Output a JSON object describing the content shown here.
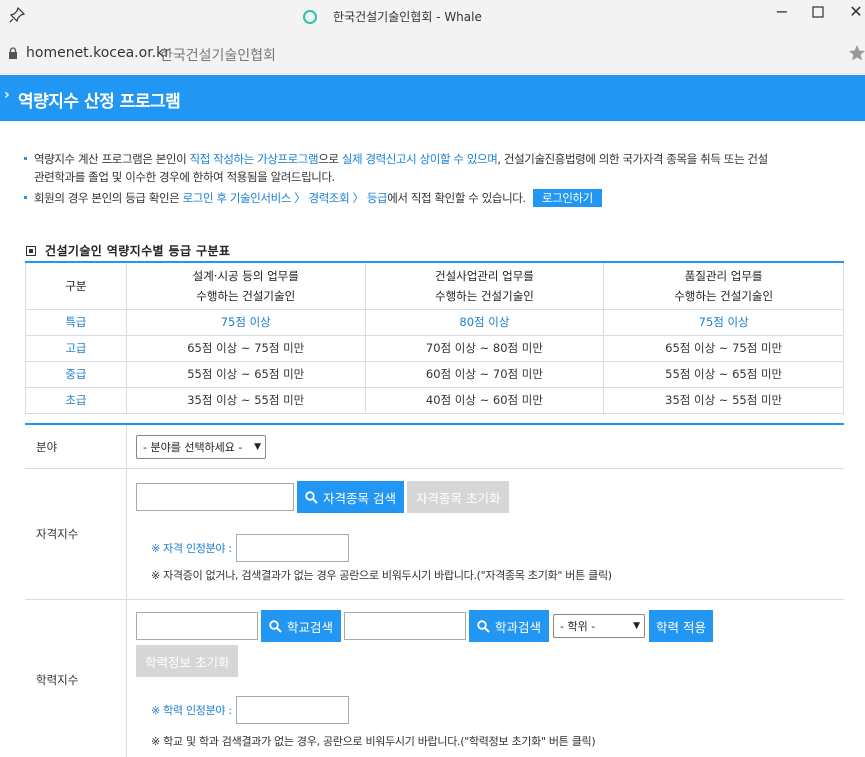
{
  "browser": {
    "window_title": "한국건설기술인협회 - Whale",
    "url": "homenet.kocea.or.kr",
    "page_title": "한국건설기술인협회"
  },
  "header": {
    "chevron": "›",
    "title": "역량지수 산정 프로그램"
  },
  "intro": {
    "line1": {
      "p1": "역량지수 계산 프로그램은 본인이 ",
      "h1": "직접 작성하는 가상프로그램",
      "p2": "으로 ",
      "h2": "실제 경력신고시 상이할 수 있으며",
      "p3": ", 건설기술진흥법령에 의한 국가자격 종목을 취득 또는 건설",
      "p4": "관련학과를 졸업 및 이수한 경우에 한하여 적용됨을 알려드립니다."
    },
    "line2": {
      "p1": "회원의 경우 본인의 등급 확인은 ",
      "h1": "로그인 후 기술인서비스 〉 경력조회 〉 등급",
      "p2": "에서 직접 확인할 수 있습니다.",
      "login_button": "로그인하기"
    }
  },
  "grade_table": {
    "title": "건설기술인 역량지수별 등급 구분표",
    "headers": [
      {
        "l1": "구분",
        "l2": ""
      },
      {
        "l1": "설계·시공 등의 업무를",
        "l2": "수행하는 건설기술인"
      },
      {
        "l1": "건설사업관리 업무를",
        "l2": "수행하는 건설기술인"
      },
      {
        "l1": "품질관리 업무를",
        "l2": "수행하는 건설기술인"
      }
    ],
    "rows": [
      [
        "특급",
        "75점 이상",
        "80점 이상",
        "75점 이상"
      ],
      [
        "고급",
        "65점 이상 ~ 75점 미만",
        "70점 이상 ~ 80점 미만",
        "65점 이상 ~ 75점 미만"
      ],
      [
        "중급",
        "55점 이상 ~ 65점 미만",
        "60점 이상 ~ 70점 미만",
        "55점 이상 ~ 65점 미만"
      ],
      [
        "초급",
        "35점 이상 ~ 55점 미만",
        "40점 이상 ~ 60점 미만",
        "35점 이상 ~ 55점 미만"
      ]
    ]
  },
  "form": {
    "field": {
      "label": "분야",
      "select_value": "- 분야를 선택하세요 -"
    },
    "license": {
      "label": "자격지수",
      "search_button": "자격종목 검색",
      "reset_button": "자격종목 초기화",
      "recognized_label": "※ 자격 인정분야 :",
      "note": "※ 자격증이 없거나, 검색결과가 없는 경우 공란으로 비워두시기 바랍니다.(\"자격종목 초기화\" 버튼 클릭)"
    },
    "education": {
      "label": "학력지수",
      "school_button": "학교검색",
      "dept_button": "학과검색",
      "degree_select": "- 학위 -",
      "apply_button": "학력 적용",
      "reset_button": "학력정보 초기화",
      "recognized_label": "※ 학력 인정분야 :",
      "note": "※ 학교 및 학과 검색결과가 없는 경우, 공란으로 비워두시기 바랍니다.(\"학력정보 초기화\" 버튼 클릭)"
    }
  },
  "colors": {
    "accent": "#2196f3",
    "link": "#1a7fd4",
    "disabled": "#d6d6d6"
  }
}
